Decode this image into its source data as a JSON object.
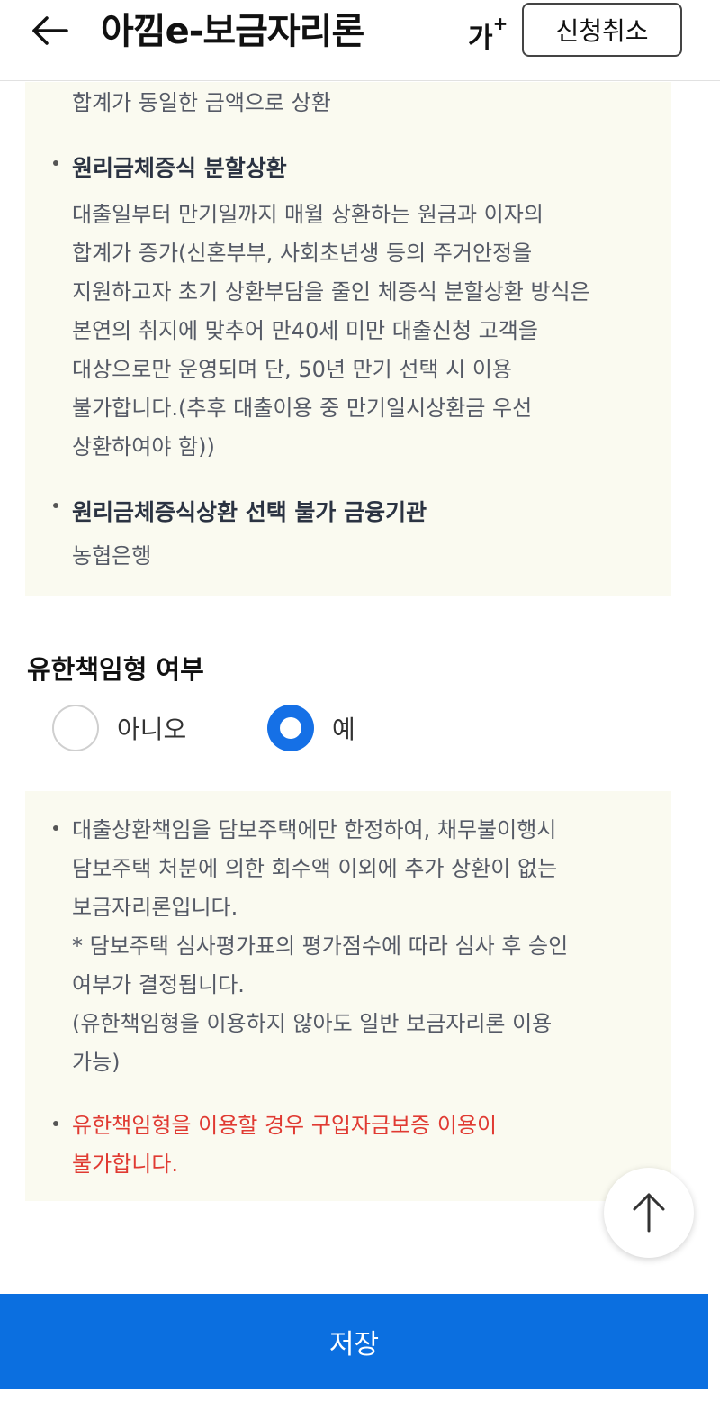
{
  "header": {
    "title": "아낌e-보금자리론",
    "font_size_label": "가",
    "font_size_plus": "+",
    "cancel_label": "신청취소"
  },
  "repayment_info": {
    "intro_line": "합계가 동일한 금액으로 상환",
    "items": [
      {
        "title": "원리금체증식 분할상환",
        "lines": [
          "대출일부터 만기일까지 매월 상환하는 원금과 이자의",
          "합계가 증가(신혼부부, 사회초년생 등의 주거안정을",
          "지원하고자 초기 상환부담을 줄인 체증식 분할상환 방식은",
          "본연의 취지에 맞추어 만40세 미만 대출신청 고객을",
          "대상으로만 운영되며 단, 50년 만기 선택 시 이용",
          "불가합니다.(추후 대출이용 중 만기일시상환금 우선",
          "상환하여야 함))"
        ]
      },
      {
        "title": "원리금체증식상환 선택 불가 금융기관",
        "lines": [
          "농협은행"
        ]
      }
    ]
  },
  "limited_liability": {
    "title": "유한책임형 여부",
    "options": [
      {
        "label": "아니오",
        "selected": false
      },
      {
        "label": "예",
        "selected": true
      }
    ],
    "notes": [
      "대출상환책임을 담보주택에만 한정하여, 채무불이행시",
      "담보주택 처분에 의한 회수액 이외에 추가 상환이 없는",
      "보금자리론입니다.",
      "* 담보주택 심사평가표의 평가점수에 따라 심사 후 승인",
      "여부가 결정됩니다.",
      "(유한책임형을 이용하지 않아도 일반 보금자리론 이용",
      "가능)"
    ],
    "warning": [
      "유한책임형을 이용할 경우 구입자금보증 이용이",
      "불가합니다."
    ]
  },
  "footer": {
    "save_label": "저장"
  },
  "colors": {
    "primary": "#0b6fe0",
    "radio_selected": "#1570e6",
    "warning": "#e03a32",
    "info_bg": "#fafaf0"
  },
  "icons": {
    "back": "arrow-left-icon",
    "scroll_top": "arrow-up-icon"
  }
}
